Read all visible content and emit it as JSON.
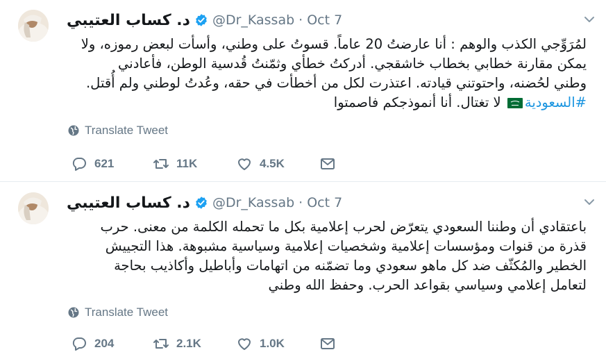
{
  "colors": {
    "text": "#14171a",
    "secondary": "#657786",
    "link": "#1b95e0",
    "verified": "#1da1f2",
    "divider": "#e6ecf0"
  },
  "tweets": [
    {
      "name": "د. كساب العتيبي",
      "handle": "@Dr_Kassab",
      "separator": "·",
      "date": "Oct 7",
      "lines": [
        "لمُرَوِّجي الكذب والوهم : أنا عارضتُ 20 عاماً. قسوتُ على وطني، وأسأت لبعض رموزه، ولا",
        "يمكن مقارنة خطابي بخطاب خاشقجي. أدركتُ خطأي وثمّنتُ قُدسية الوطن، فأعادني",
        "وطني لحُضنه، واحتوتني قيادته. اعتذرت لكل من أخطأت في حقه، وعُدتُ لوطني ولم أُقتل."
      ],
      "hashtag": "#السعودية",
      "last_line_rest": "لا تغتال. أنا أنموذجكم فاصمتوا",
      "translate_label": "Translate Tweet",
      "replies": "621",
      "retweets": "11K",
      "likes": "4.5K"
    },
    {
      "name": "د. كساب العتيبي",
      "handle": "@Dr_Kassab",
      "separator": "·",
      "date": "Oct 7",
      "lines": [
        "باعتقادي أن وطننا السعودي يتعرّض لحرب إعلامية بكل ما تحمله الكلمة من معنى. حرب",
        "قذرة من قنوات ومؤسسات إعلامية وشخصيات إعلامية وسياسية مشبوهة. هذا التجييش",
        "الخطير والمُكثّف ضد كل ماهو سعودي وما تضمّنه من اتهامات وأباطيل وأكاذيب بحاجة",
        "لتعامل إعلامي وسياسي بقواعد الحرب. وحفظ الله وطني"
      ],
      "translate_label": "Translate Tweet",
      "replies": "204",
      "retweets": "2.1K",
      "likes": "1.0K"
    }
  ]
}
